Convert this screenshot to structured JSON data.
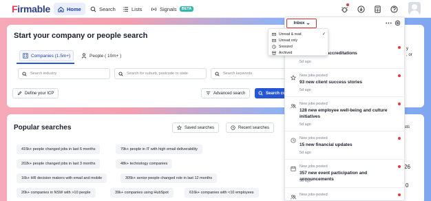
{
  "app": {
    "logo_text": "irmable",
    "logo_mark": "F"
  },
  "nav": {
    "home": "Home",
    "search": "Search",
    "lists": "Lists",
    "signals": "Signals",
    "beta": "BETA"
  },
  "search_card": {
    "title": "Start your company or people search",
    "tab_companies": "Companies (1.5m+)",
    "tab_people": "People ( 10m+ )",
    "industry_placeholder": "Search industry",
    "location_placeholder": "Search for suburb, postcode or state",
    "keywords_placeholder": "Search keywords",
    "define_icp": "Define your ICP",
    "advanced_search": "Advanced search",
    "search_button": "Search co"
  },
  "popular": {
    "title": "Popular searches",
    "saved": "Saved searches",
    "recent": "Recent searches",
    "chips": [
      "415k+ people changed jobs in last 6 months",
      "79k+ people in IT with high email deliverability",
      "202k+ people changed jobs in last 3 months",
      "48k+ technology companies",
      "16k+ HR decision makers with email and mobile",
      "305k+ senior people changed role in last 12 months",
      "20k+ companies in NSW with >10 people",
      "39k+ companies using HubSpot",
      "616k+ companies with <10 employees"
    ]
  },
  "right_fragments": {
    "a": "y",
    "b": ", or",
    "c": "ists",
    "d": "26",
    "e": "0"
  },
  "inbox": {
    "label": "Inbox",
    "filter_options": [
      {
        "label": "Unread & read",
        "selected": true
      },
      {
        "label": "Unread only",
        "selected": false
      },
      {
        "label": "Snoozed",
        "selected": false
      },
      {
        "label": "Archived",
        "selected": false
      }
    ],
    "notifications": [
      {
        "kind": "",
        "title": "ications and accreditations",
        "age": "5d ago",
        "icon": "award-icon",
        "unread": true
      },
      {
        "kind": "New jobs posted",
        "title": "93 new client success stories",
        "age": "5d ago",
        "icon": "star-icon",
        "unread": true
      },
      {
        "kind": "New jobs posted",
        "title": "128 new employee well-being and culture initiatives",
        "age": "5d ago",
        "icon": "people-icon",
        "unread": true
      },
      {
        "kind": "New jobs posted",
        "title": "15 new financial updates",
        "age": "5d ago",
        "icon": "clock-icon",
        "unread": true
      },
      {
        "kind": "New jobs posted",
        "title": "357 new event participation and announcements",
        "age": "5d ago",
        "icon": "calendar-icon",
        "unread": true
      },
      {
        "kind": "New jobs posted",
        "title": "",
        "age": "",
        "icon": "people-icon",
        "unread": true
      }
    ]
  },
  "colors": {
    "accent": "#2456d6",
    "alert": "#e53935",
    "beta": "#31b8a8"
  }
}
